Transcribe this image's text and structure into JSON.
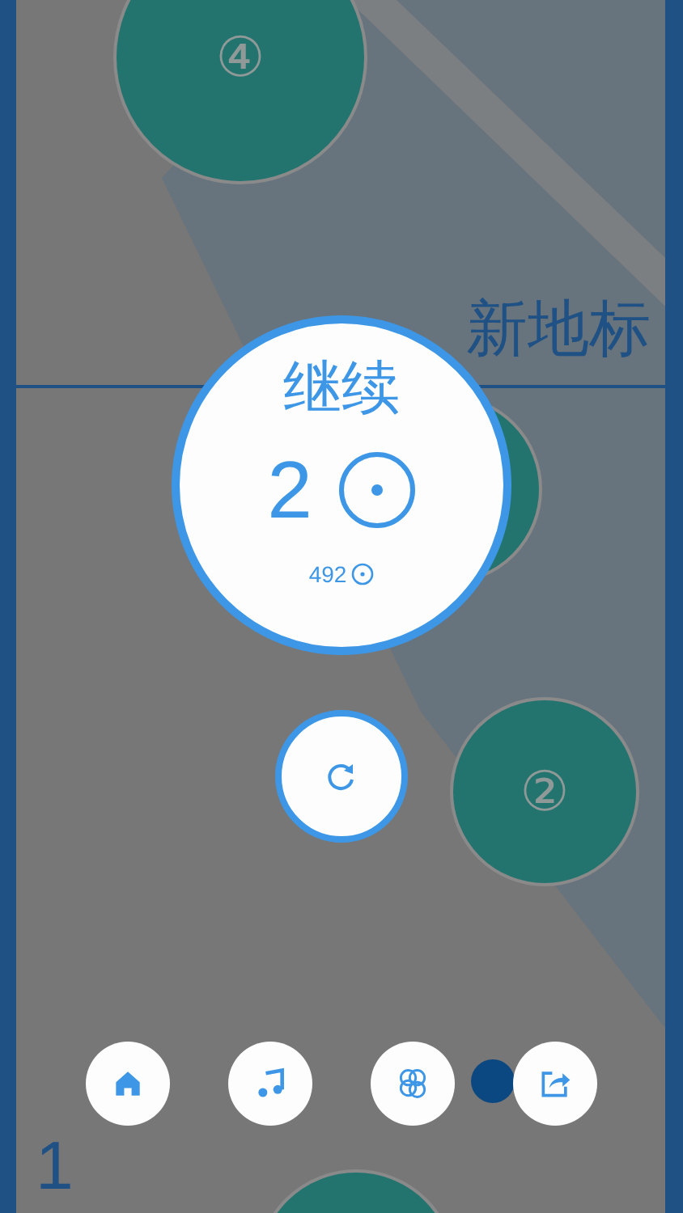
{
  "landmarks": [
    {
      "label": "④"
    },
    {
      "label": "②"
    }
  ],
  "new_landmark": "新地标",
  "dialog": {
    "title": "继续",
    "count": "2",
    "score": "492"
  },
  "toolbar": [
    {
      "kind": "home"
    },
    {
      "kind": "music"
    },
    {
      "kind": "themes"
    },
    {
      "kind": "share"
    }
  ],
  "level": "1"
}
